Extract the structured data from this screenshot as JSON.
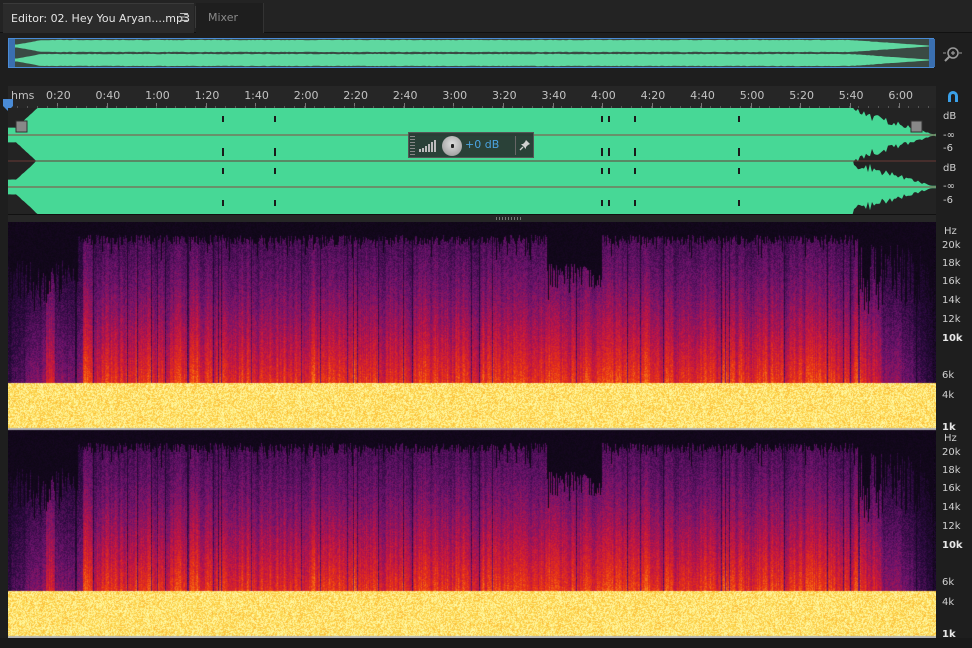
{
  "tabs": {
    "editor_label": "Editor: 02. Hey You Aryan....mp3",
    "menu_glyph": "☰",
    "mixer_label": "Mixer"
  },
  "timeline": {
    "unit_label": "hms",
    "ticks": [
      "0:20",
      "0:40",
      "1:00",
      "1:20",
      "1:40",
      "2:00",
      "2:20",
      "2:40",
      "3:00",
      "3:20",
      "3:40",
      "4:00",
      "4:20",
      "4:40",
      "5:00",
      "5:20",
      "5:40",
      "6:00"
    ]
  },
  "hud": {
    "volume_label": "+0 dB"
  },
  "db_scale": {
    "unit": "dB",
    "labels": [
      "-∞",
      "-6"
    ]
  },
  "hz_scale": {
    "unit": "Hz",
    "labels": [
      "20k",
      "18k",
      "16k",
      "14k",
      "12k",
      "10k",
      "6k",
      "4k",
      "1k"
    ],
    "bold": [
      "10k",
      "1k"
    ]
  },
  "colors": {
    "waveform": "#47d896",
    "overview_wave": "#5fd8a0",
    "selection_border": "#4a8bd6",
    "accent_blue": "#4aa3e0"
  },
  "icons": {
    "zoom": "zoom-icon",
    "snap": "magnet-icon",
    "pin": "pin-icon",
    "playhead": "playhead-icon"
  }
}
